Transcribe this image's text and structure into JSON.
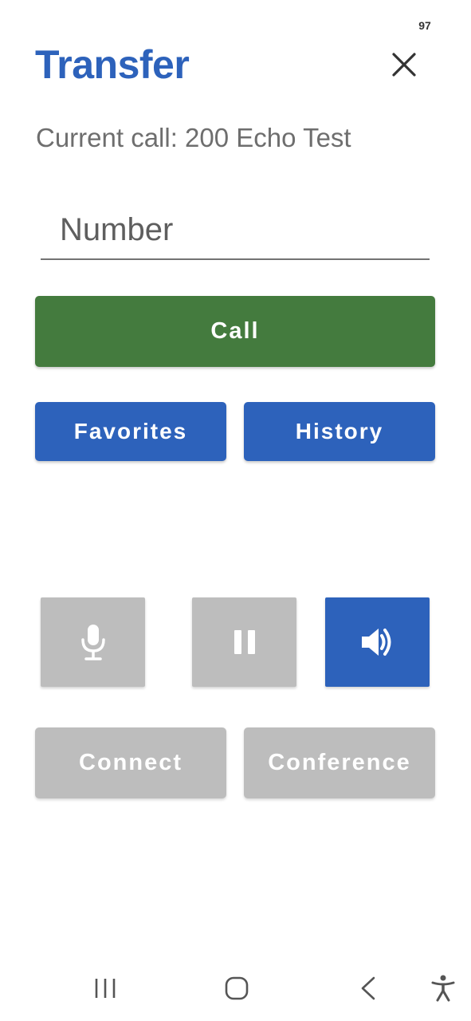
{
  "status_bar": {
    "battery": "97"
  },
  "header": {
    "title": "Transfer",
    "close_icon": "close-icon"
  },
  "call": {
    "current_call_text": "Current call: 200 Echo Test"
  },
  "number_input": {
    "placeholder": "Number",
    "value": ""
  },
  "buttons": {
    "call": "Call",
    "favorites": "Favorites",
    "history": "History",
    "connect": "Connect",
    "conference": "Conference"
  },
  "controls": {
    "mute": {
      "icon": "microphone-icon",
      "active": false
    },
    "hold": {
      "icon": "pause-icon",
      "active": false
    },
    "speaker": {
      "icon": "speaker-icon",
      "active": true
    }
  },
  "colors": {
    "primary_blue": "#2d62bb",
    "call_green": "#447b3e",
    "disabled_gray": "#bdbdbd",
    "secondary_text": "#6e6e6e"
  },
  "nav_bar": {
    "items": [
      "recent-apps-icon",
      "home-icon",
      "back-icon",
      "accessibility-icon"
    ]
  }
}
